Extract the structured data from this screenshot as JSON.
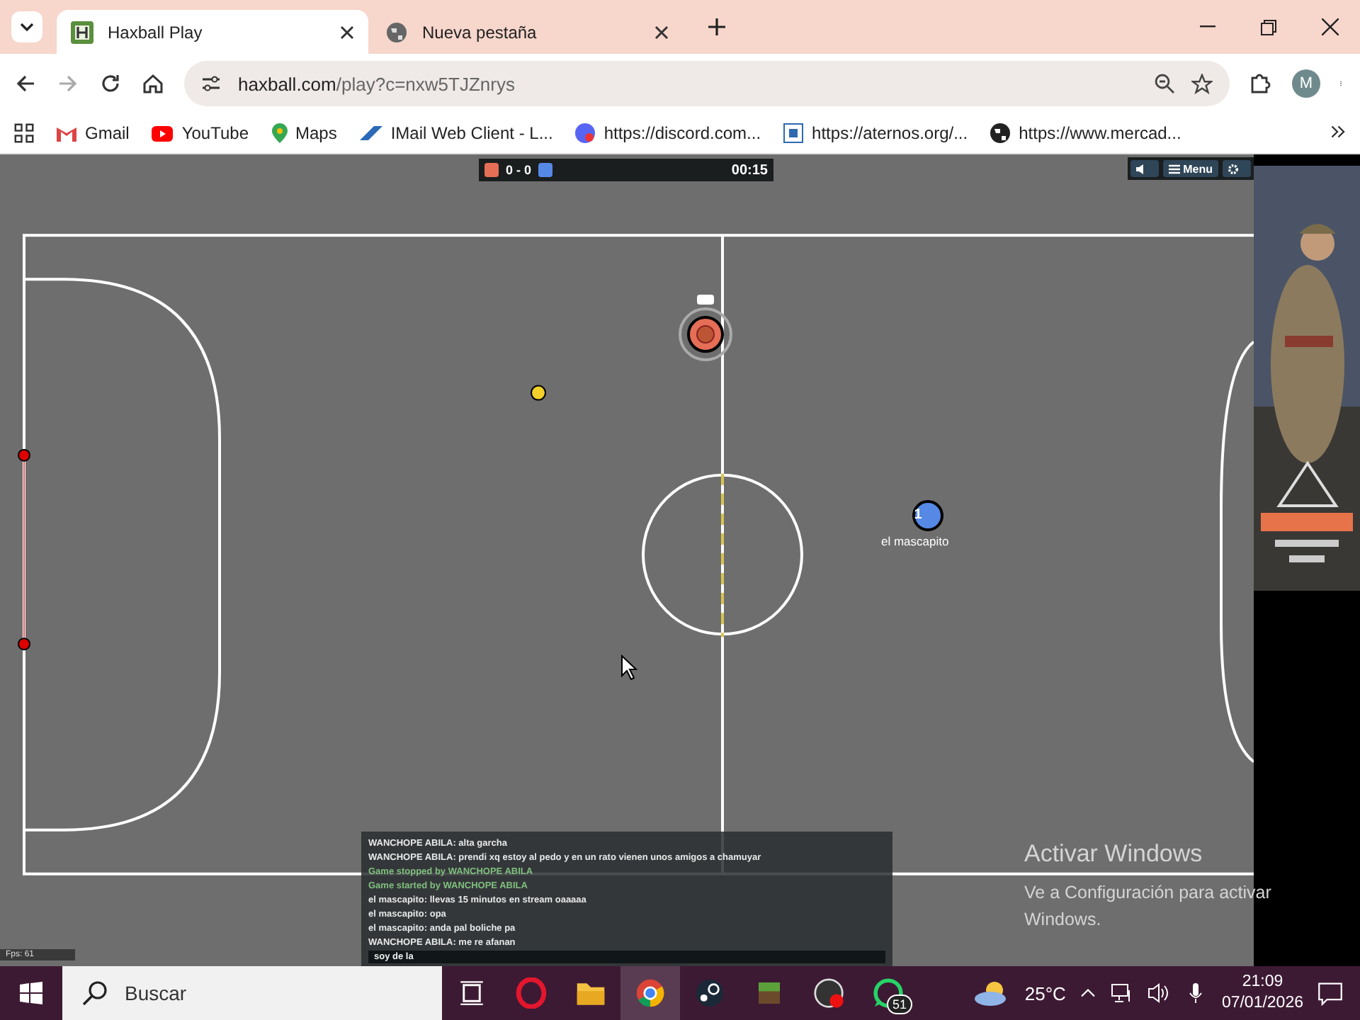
{
  "browser": {
    "tabs": [
      {
        "title": "Haxball Play",
        "selected": true
      },
      {
        "title": "Nueva pestaña",
        "selected": false
      }
    ],
    "address": {
      "host": "haxball.com",
      "path": "/play?c=nxw5TJZnrys"
    },
    "profile_initial": "M",
    "bookmarks": [
      "Gmail",
      "YouTube",
      "Maps",
      "IMail Web Client - L...",
      "https://discord.com...",
      "https://aternos.org/...",
      "https://www.mercad..."
    ]
  },
  "game": {
    "score": "0 - 0",
    "timer": "00:15",
    "menu_label": "Menu",
    "players": [
      {
        "color": "#e56e56",
        "kind": "host"
      },
      {
        "color": "#5689e5",
        "kind": "plain",
        "number": "1",
        "name": "el mascapito"
      }
    ],
    "chat": [
      {
        "kind": "player",
        "text": "WANCHOPE ABILA: alta garcha"
      },
      {
        "kind": "player",
        "text": "WANCHOPE ABILA: prendi xq estoy al pedo y en un rato vienen unos amigos a chamuyar"
      },
      {
        "kind": "system",
        "text": "Game stopped by WANCHOPE ABILA"
      },
      {
        "kind": "system",
        "text": "Game started by WANCHOPE ABILA"
      },
      {
        "kind": "player",
        "text": "el mascapito: llevas 15 minutos en stream oaaaaa"
      },
      {
        "kind": "player",
        "text": "el mascapito: opa"
      },
      {
        "kind": "player",
        "text": "el mascapito: anda pal boliche pa"
      },
      {
        "kind": "player",
        "text": "WANCHOPE ABILA: me re afanan"
      }
    ],
    "chat_input": "soy de la",
    "fps": "Fps: 61"
  },
  "windows_activation": {
    "title": "Activar Windows",
    "body": "Ve a Configuración para activar Windows."
  },
  "taskbar": {
    "search_placeholder": "Buscar",
    "whatsapp_badge": "51",
    "weather": "25°C",
    "time": "21:09",
    "date": "07/01/2026"
  }
}
